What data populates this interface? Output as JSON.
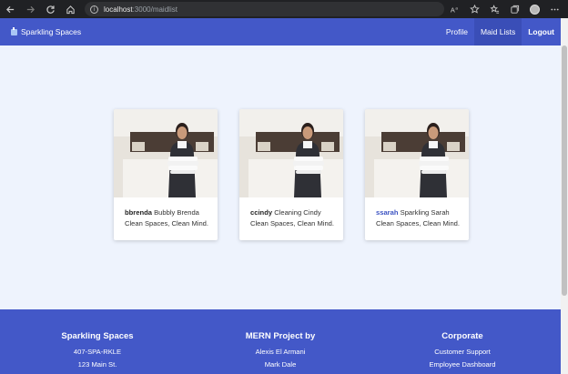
{
  "browser": {
    "url_host": "localhost",
    "url_path": ":3000/maidlist"
  },
  "navbar": {
    "brand": "Sparkling Spaces",
    "links": [
      "Profile",
      "Maid Lists",
      "Logout"
    ]
  },
  "cards": [
    {
      "username": "bbrenda",
      "name": "Bubbly Brenda",
      "tagline": "Clean Spaces, Clean Mind."
    },
    {
      "username": "ccindy",
      "name": "Cleaning Cindy",
      "tagline": "Clean Spaces, Clean Mind."
    },
    {
      "username": "ssarah",
      "name": "Sparkling Sarah",
      "tagline": "Clean Spaces, Clean Mind."
    }
  ],
  "footer": {
    "col1": {
      "title": "Sparkling Spaces",
      "lines": [
        "407-SPA-RKLE",
        "123 Main St."
      ]
    },
    "col2": {
      "title": "MERN Project by",
      "lines": [
        "Alexis El Armani",
        "Mark Dale"
      ]
    },
    "col3": {
      "title": "Corporate",
      "lines": [
        "Customer Support",
        "Employee Dashboard"
      ]
    }
  }
}
